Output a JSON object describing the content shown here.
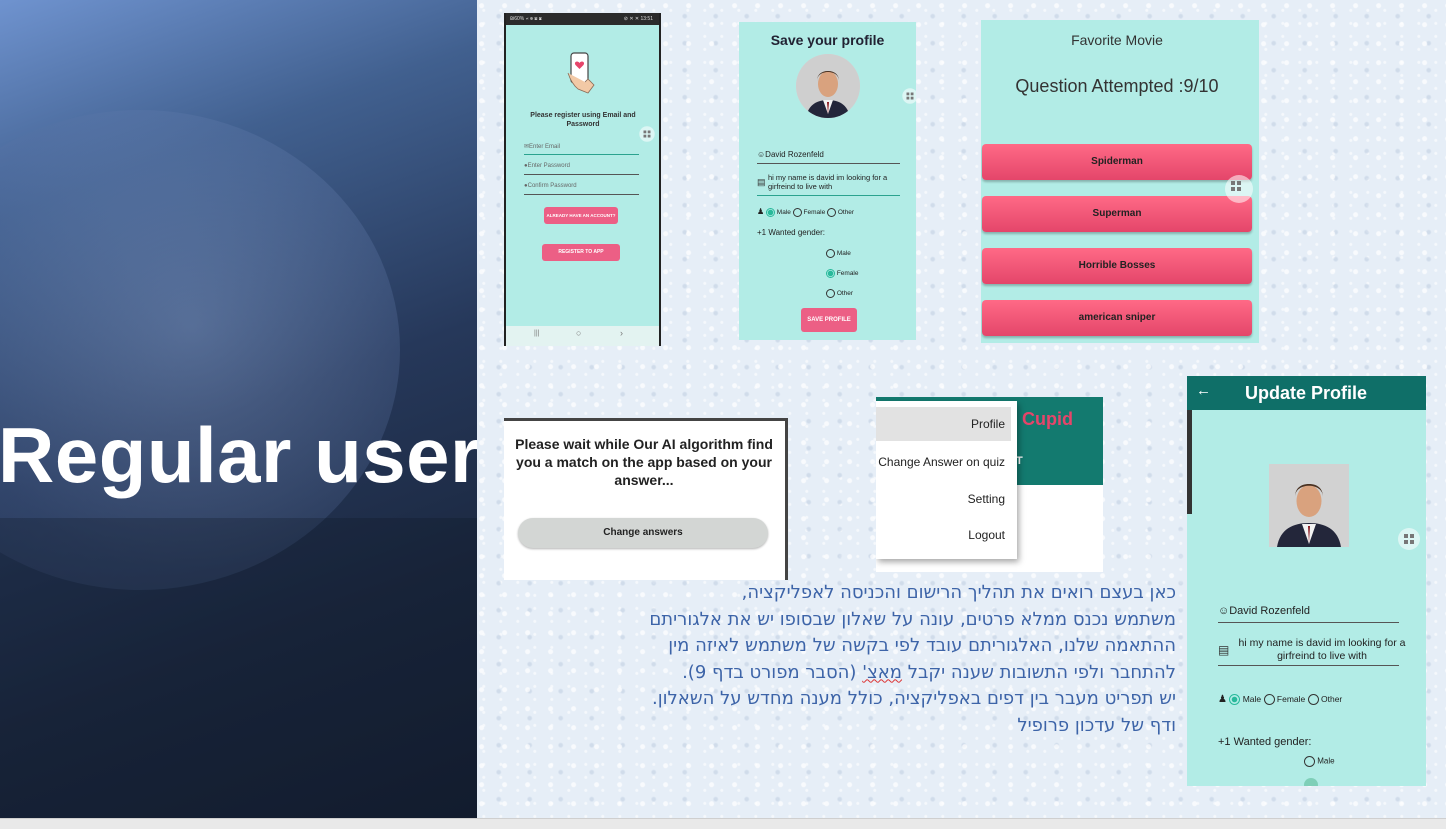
{
  "slide_title": "Regular user",
  "colors": {
    "accent": "#ec5f85",
    "teal_bg": "#b2ece6",
    "header_teal": "#0f6f68",
    "description_text": "#3d64a8"
  },
  "register_screen": {
    "status_left": "₪60% ⑁ ⊕ ▣ ▣",
    "status_right": "⊘ ✕ ✕ 13:51",
    "icon": "phone-heart-icon",
    "prompt": "Please register using Email and Password",
    "email_placeholder": "Enter Email",
    "password_placeholder": "Enter Password",
    "confirm_placeholder": "Confirm Password",
    "account_button": "ALREADY HAVE AN ACCOUNT?",
    "register_button": "REGISTER TO APP",
    "nav_recent": "|||",
    "nav_home": "○",
    "nav_back": "›"
  },
  "save_profile_screen": {
    "title": "Save your profile",
    "name": "David Rozenfeld",
    "bio": "hi my name is david im looking for a girfreind to live with",
    "gender_options": [
      "Male",
      "Female",
      "Other"
    ],
    "gender_selected": "Male",
    "wanted_label": "+1 Wanted gender:",
    "wanted_options": [
      "Male",
      "Female",
      "Other"
    ],
    "wanted_selected": "Female",
    "save_button": "SAVE PROFILE"
  },
  "quiz_screen": {
    "title": "Favorite Movie",
    "progress": "Question Attempted :9/10",
    "answers": [
      "Spiderman",
      "Superman",
      "Horrible Bosses",
      "american sniper"
    ]
  },
  "waiting_screen": {
    "message": "Please wait while Our AI algorithm find you a match on the app based on your answer...",
    "change_button": "Change answers"
  },
  "menu_screen": {
    "app_title": "Cupid",
    "tab_fragment": "T",
    "items": [
      "Profile",
      "Change Answer on quiz",
      "Setting",
      "Logout"
    ]
  },
  "update_profile_screen": {
    "title": "Update Profile",
    "name": "David Rozenfeld",
    "bio": "hi my name is david im looking for a girfreind to live with",
    "gender_options": [
      "Male",
      "Female",
      "Other"
    ],
    "gender_selected": "Male",
    "wanted_label": "+1 Wanted gender:",
    "wanted_first": "Male"
  },
  "description": {
    "line1": "כאן בעצם רואים את תהליך הרישום והכניסה לאפליקציה,",
    "line2": "משתמש נכנס ממלא פרטים, עונה על שאלון שבסופו יש את אלגוריתם",
    "line3": "ההתאמה שלנו, האלגוריתם עובד לפי בקשה של משתמש לאיזה מין",
    "line4_pre": "להתחבר ולפי התשובות שענה יקבל ",
    "line4_word": "מאצ'",
    "line4_post": " (הסבר מפורט בדף 9).",
    "line5": "יש תפריט מעבר בין דפים באפליקציה, כולל מענה מחדש על השאלון.",
    "line6": "ודף של עדכון פרופיל"
  }
}
